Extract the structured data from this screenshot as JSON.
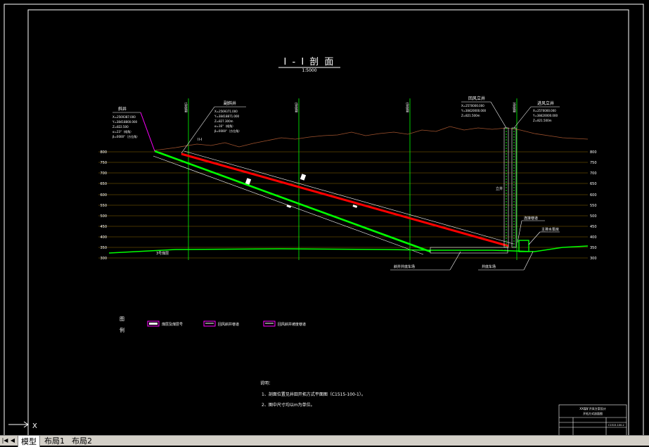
{
  "drawing": {
    "title": "I - I 剖 面",
    "scale": "1:5000",
    "section_marker": "II-I",
    "elevations": [
      "800",
      "750",
      "700",
      "650",
      "600",
      "550",
      "500",
      "450",
      "400",
      "350",
      "300"
    ],
    "wells": [
      {
        "name": "斜井",
        "notes": [
          "X=2569387.000",
          "Y=38418800.000",
          "Z=822.500",
          "α=23°（倾角）",
          "β=0000°（方位角）"
        ]
      },
      {
        "name": "副斜井",
        "notes": [
          "X=2569371.000",
          "Y=38418871.000",
          "Z=827.300m",
          "α=16°（倾角）",
          "β=0000°（方位角）"
        ]
      },
      {
        "name": "回风立井",
        "notes": [
          "X=2570000.000",
          "Y=38420000.000",
          "Z=821.500m"
        ]
      },
      {
        "name": "进风立井",
        "notes": [
          "X=2570000.000",
          "Y=38420000.000",
          "Z=821.500m"
        ]
      }
    ],
    "exploration_lines": [
      "勘探线1",
      "勘探线2",
      "勘探线3",
      "勘探线4"
    ],
    "annotations": {
      "coal_seam": "3号煤层",
      "shaft_bottom_left": "斜井井底车场",
      "shaft_bottom_right": "井底车场",
      "pump_room": "主排水泵房",
      "connection": "连接巷道",
      "vertical_label": "立井"
    },
    "legend": {
      "title_1": "图",
      "title_2": "例",
      "items": [
        {
          "label": "煤层及煤层号",
          "color": "#ff00ff"
        },
        {
          "label": "回风斜井巷道",
          "color": "#ff00ff"
        },
        {
          "label": "回风斜井坡度巷道",
          "color": "#ff00ff"
        }
      ]
    },
    "notes": {
      "heading": "说明：",
      "items": [
        "1、剖面位置见井田开拓方式平面图（C1515-100-1）。",
        "2、图中尺寸均以m为单位。"
      ]
    },
    "title_block": {
      "line1": "XX煤矿开采方案设计",
      "line2": "开拓方式剖面图",
      "row": "C1515-100-2"
    },
    "ucs_label": "X"
  },
  "tabs": {
    "items": [
      "模型",
      "布局1",
      "布局2"
    ],
    "active": 0
  },
  "colors": {
    "red": "#ff0000",
    "green": "#00ff00",
    "white": "#ffffff",
    "brown": "#8b4513",
    "olive": "#a0a000",
    "magenta": "#ff00ff"
  }
}
